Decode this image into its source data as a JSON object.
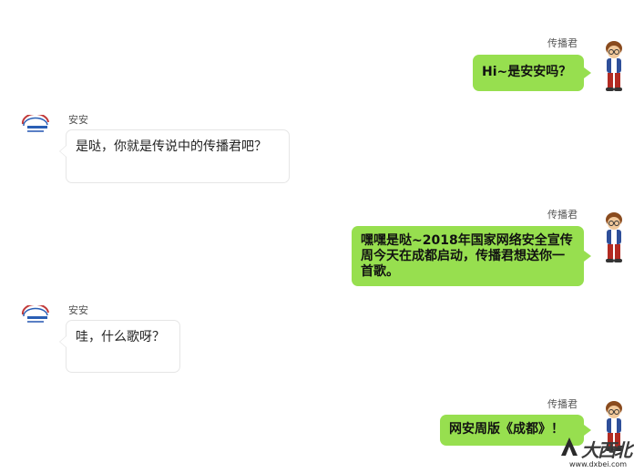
{
  "messages": [
    {
      "sender": "传播君",
      "text": "Hi~是安安吗？"
    },
    {
      "sender": "安安",
      "text": "是哒，你就是传说中的传播君吧？"
    },
    {
      "sender": "传播君",
      "text": "嘿嘿是哒~2018年国家网络安全宣传周今天在成都启动，传播君想送你一首歌。"
    },
    {
      "sender": "安安",
      "text": "哇，什么歌呀？"
    },
    {
      "sender": "传播君",
      "text": "网安周版《成都》！"
    }
  ],
  "watermark": {
    "text": "大西北",
    "url": "www.dxbei.com"
  },
  "colors": {
    "green_bubble": "#97df4f",
    "white_bubble_border": "#e6e6e6"
  },
  "icons": [
    "cartoon-boy-avatar",
    "network-security-logo-avatar",
    "watermark-emblem-icon"
  ]
}
